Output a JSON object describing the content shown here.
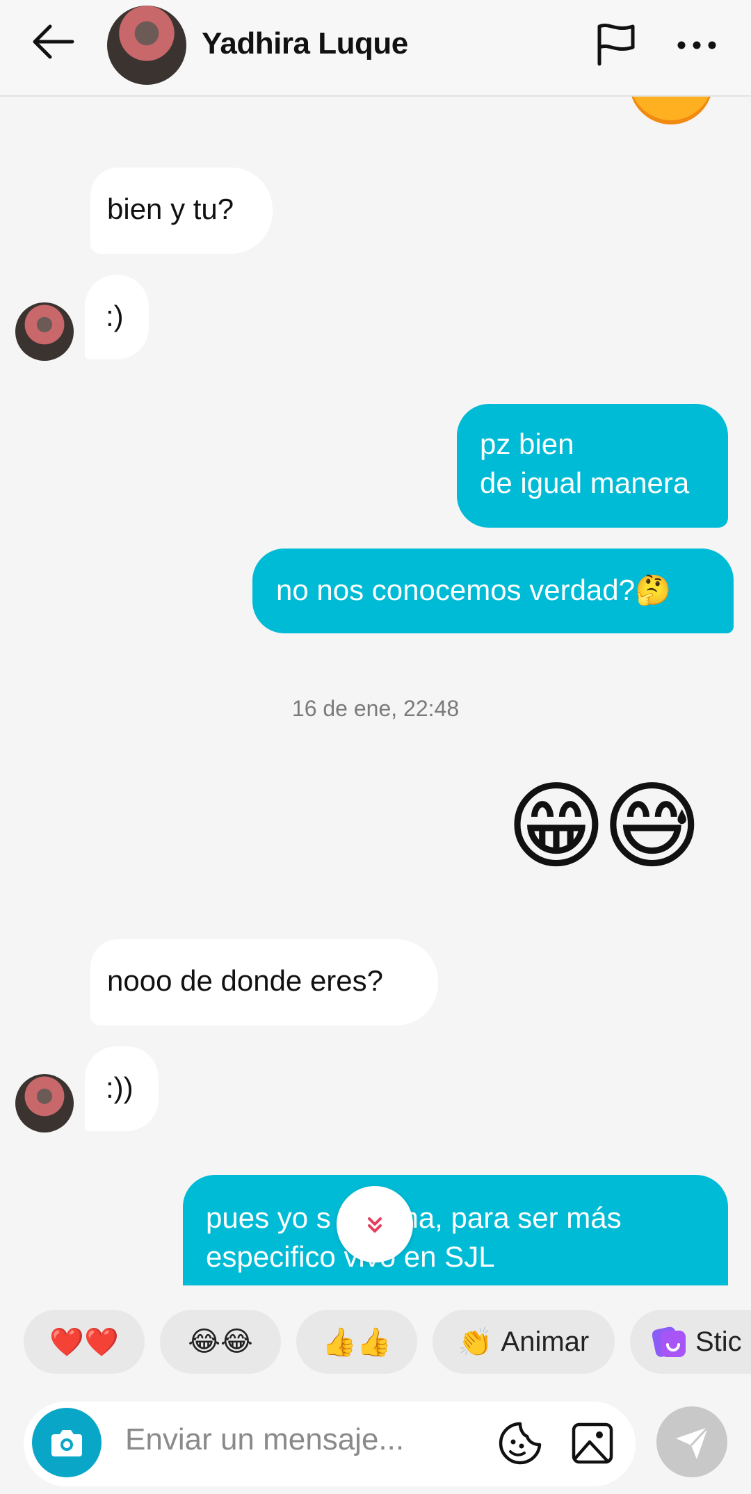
{
  "header": {
    "contact_name": "Yadhira Luque",
    "icons": [
      "back-arrow-icon",
      "flag-icon",
      "more-icon"
    ]
  },
  "messages": [
    {
      "side": "in",
      "text": "bien y tu?"
    },
    {
      "side": "in",
      "text": ":)"
    },
    {
      "side": "out",
      "line1": "pz bien",
      "line2": "de igual manera"
    },
    {
      "side": "out",
      "text": "no nos conocemos verdad?🤔"
    },
    {
      "type": "timestamp",
      "text": "16 de ene, 22:48"
    },
    {
      "side": "out",
      "type": "emoji",
      "text": "😁😅"
    },
    {
      "side": "in",
      "text": "nooo de donde eres?"
    },
    {
      "side": "in",
      "text": ":))"
    },
    {
      "side": "out",
      "line1": "pues yo s  e Lima, para ser más",
      "line2": "especifico vivo en SJL"
    }
  ],
  "quick_replies": [
    {
      "label": "❤️❤️"
    },
    {
      "label": "😂😂"
    },
    {
      "label": "👍👍"
    },
    {
      "icon": "👏",
      "label": "Animar"
    },
    {
      "icon": "sticker-icon",
      "label": "Stic"
    }
  ],
  "input": {
    "placeholder": "Enviar un mensaje...",
    "icons": [
      "camera-icon",
      "sticker-icon",
      "gallery-icon",
      "send-icon"
    ]
  },
  "colors": {
    "outgoing_bubble": "#00bbd6",
    "incoming_bubble": "#ffffff",
    "background": "#f5f5f5",
    "camera_button": "#0aa6c8",
    "send_button": "#c8c8c8"
  }
}
